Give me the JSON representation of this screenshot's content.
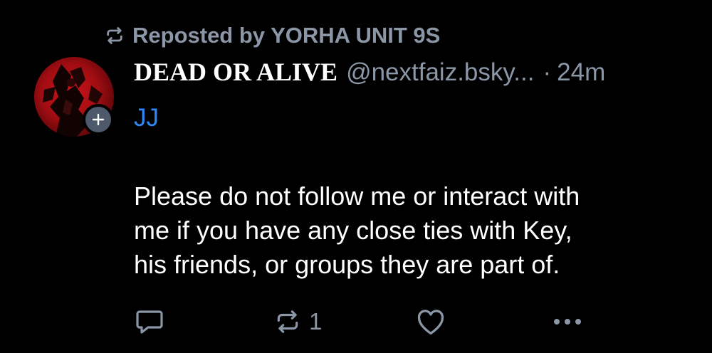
{
  "repost": {
    "label": "Reposted by YORHA UNIT 9S",
    "icon": "repost-icon"
  },
  "author": {
    "display_name": "DEAD OR ALIVE",
    "handle": "@nextfaiz.bsky...",
    "separator": "·",
    "time": "24m",
    "avatar_icon": "avatar-image",
    "follow_icon": "plus-icon"
  },
  "post": {
    "tag": "JJ",
    "lines": [
      "Please do not follow me or interact with",
      "me if you have any close ties with Key,",
      "his friends, or groups they are part of."
    ]
  },
  "actions": {
    "reply_icon": "reply-icon",
    "repost_icon": "repost-icon",
    "repost_count": "1",
    "like_icon": "heart-icon",
    "more_icon": "more-icon"
  },
  "colors": {
    "background": "#000000",
    "muted": "#8b97a6",
    "accent": "#2f86f7",
    "text": "#ffffff"
  }
}
